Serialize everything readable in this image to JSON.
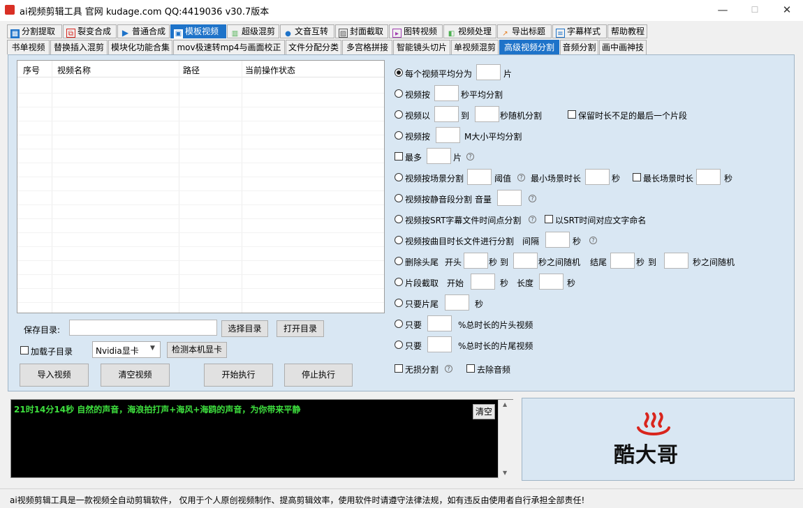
{
  "window": {
    "title": "ai视频剪辑工具 官网 kudage.com QQ:4419036   v30.7版本",
    "controls": {
      "minimize": "—",
      "maximize": "☐",
      "close": "✕"
    }
  },
  "main_tabs": [
    {
      "label": "分割提取",
      "icon": "split-icon"
    },
    {
      "label": "裂变合成",
      "icon": "copy-icon"
    },
    {
      "label": "普通合成",
      "icon": "play-icon"
    },
    {
      "label": "模板视频",
      "icon": "grid-icon"
    },
    {
      "label": "超级混剪",
      "icon": "bars-icon"
    },
    {
      "label": "文音互转",
      "icon": "mic-icon"
    },
    {
      "label": "封面截取",
      "icon": "image-icon"
    },
    {
      "label": "图转视频",
      "icon": "film-icon"
    },
    {
      "label": "视频处理",
      "icon": "video-icon"
    },
    {
      "label": "导出标题",
      "icon": "export-icon"
    },
    {
      "label": "字幕样式",
      "icon": "subtitle-icon"
    },
    {
      "label": "帮助教程",
      "icon": ""
    }
  ],
  "sub_tabs": [
    "书单视频",
    "替换插入混剪",
    "模块化功能合集",
    "mov极速转mp4与画面校正",
    "文件分配分类",
    "多宫格拼接",
    "智能镜头切片",
    "单视频混剪",
    "高级视频分割",
    "音频分割",
    "画中画神技"
  ],
  "active_sub_tab": "高级视频分割",
  "list": {
    "columns": [
      "序号",
      "视频名称",
      "路径",
      "当前操作状态"
    ]
  },
  "save_dir": {
    "label": "保存目录:",
    "value": "",
    "select_btn": "选择目录",
    "open_btn": "打开目录"
  },
  "bottom": {
    "add_subdir": "加载子目录",
    "gpu": "Nvidia显卡",
    "detect_gpu": "检测本机显卡",
    "import": "导入视频",
    "clear": "清空视频",
    "start": "开始执行",
    "stop": "停止执行"
  },
  "options": {
    "avg": {
      "pre": "每个视频平均分为",
      "post": "片"
    },
    "seconds": {
      "pre": "视频按",
      "post": "秒平均分割"
    },
    "random": {
      "pre": "视频以",
      "mid": "到",
      "post": "秒随机分割",
      "keep_last": "保留时长不足的最后一个片段"
    },
    "size": {
      "pre": "视频按",
      "post": "M大小平均分割"
    },
    "max": {
      "pre": "最多",
      "post": "片"
    },
    "scene": {
      "pre": "视频按场景分割",
      "threshold": "阈值",
      "min_label": "最小场景时长",
      "sec1": "秒",
      "max_label": "最长场景时长",
      "sec2": "秒"
    },
    "silence": {
      "pre": "视频按静音段分割",
      "vol": "音量"
    },
    "srt": {
      "pre": "视频按SRT字幕文件时间点分割",
      "name_opt": "以SRT时间对应文字命名"
    },
    "song": {
      "pre": "视频按曲目时长文件进行分割",
      "interval": "间隔",
      "post": "秒"
    },
    "trim": {
      "pre": "删除头尾",
      "start": "开头",
      "s1": "秒",
      "to1": "到",
      "rand1": "秒之间随机",
      "end": "结尾",
      "s2": "秒",
      "to2": "到",
      "rand2": "秒之间随机"
    },
    "clip": {
      "pre": "片段截取",
      "start": "开始",
      "s1": "秒",
      "len": "长度",
      "s2": "秒"
    },
    "tail": {
      "pre": "只要片尾",
      "post": "秒"
    },
    "head_pct": {
      "pre": "只要",
      "post": "%总时长的片头视频"
    },
    "tail_pct": {
      "pre": "只要",
      "post": "%总时长的片尾视频"
    },
    "lossless": "无损分割",
    "remove_audio": "去除音频"
  },
  "log": {
    "line": "21时14分14秒 自然的声音，海浪拍打声+海风+海鸥的声音，为你带来平静",
    "clear": "清空"
  },
  "logo": {
    "text": "酷大哥",
    "color": "#d9251d"
  },
  "status": "ai视频剪辑工具是一款视频全自动剪辑软件， 仅用于个人原创视频制作、提高剪辑效率，使用软件时请遵守法律法规，如有违反由使用者自行承担全部责任!",
  "colors": {
    "accent": "#1e73c9",
    "panel": "#d9e7f3",
    "log_text": "#3ee03e"
  }
}
